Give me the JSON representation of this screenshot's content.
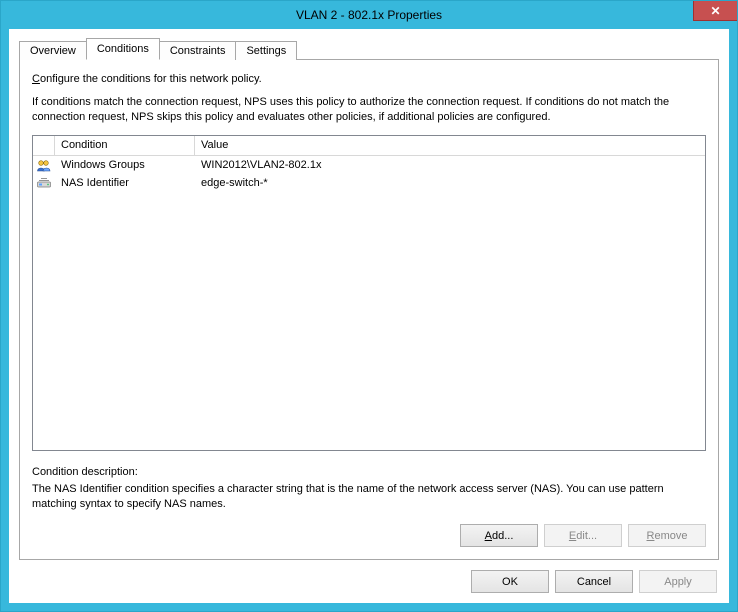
{
  "window": {
    "title": "VLAN 2 - 802.1x Properties"
  },
  "tabs": [
    {
      "label": "Overview"
    },
    {
      "label": "Conditions"
    },
    {
      "label": "Constraints"
    },
    {
      "label": "Settings"
    }
  ],
  "active_tab_index": 1,
  "instructions": {
    "line1_pre": "C",
    "line1_rest": "onfigure the conditions for this network policy.",
    "line2": "If conditions match the connection request, NPS uses this policy to authorize the connection request. If conditions do not match the connection request, NPS skips this policy and evaluates other policies, if additional policies are configured."
  },
  "list": {
    "columns": {
      "icon": "",
      "condition": "Condition",
      "value": "Value"
    },
    "rows": [
      {
        "icon": "groups-icon",
        "condition": "Windows Groups",
        "value": "WIN2012\\VLAN2-802.1x"
      },
      {
        "icon": "nas-icon",
        "condition": "NAS Identifier",
        "value": "edge-switch-*"
      }
    ]
  },
  "description": {
    "title": "Condition description:",
    "text": "The NAS Identifier condition specifies a character string that is the name of the network access server (NAS). You can use pattern matching syntax to specify NAS names."
  },
  "buttons": {
    "add": "Add...",
    "edit": "Edit...",
    "remove": "Remove",
    "ok": "OK",
    "cancel": "Cancel",
    "apply": "Apply"
  }
}
